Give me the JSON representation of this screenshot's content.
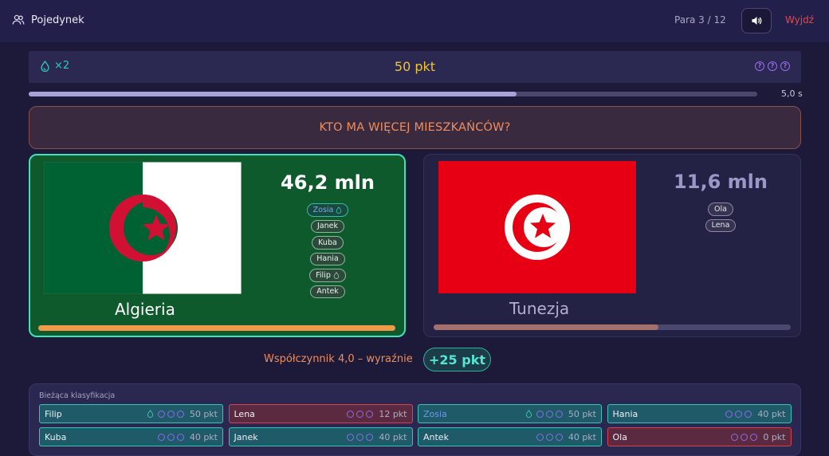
{
  "header": {
    "mode_label": "Pojedynek",
    "pair_counter": "Para 3 / 12",
    "exit_label": "Wyjdź",
    "icons": [
      "users-icon",
      "speaker-icon"
    ]
  },
  "status": {
    "streak": "×2",
    "points": "50 pkt",
    "hints_available": 3
  },
  "timer": {
    "label": "5,0 s",
    "progress": 0.67
  },
  "question": "KTO MA WIĘCEJ MIESZKAŃCÓW?",
  "left_card": {
    "country": "Algieria",
    "population": "46,2 mln",
    "vote_share": 1.0,
    "votes": [
      {
        "name": "Zosia",
        "special": true,
        "drop": true
      },
      {
        "name": "Janek",
        "special": false,
        "drop": false
      },
      {
        "name": "Kuba",
        "special": false,
        "drop": false
      },
      {
        "name": "Hania",
        "special": false,
        "drop": false
      },
      {
        "name": "Filip",
        "special": false,
        "drop": true
      },
      {
        "name": "Antek",
        "special": false,
        "drop": false
      }
    ]
  },
  "right_card": {
    "country": "Tunezja",
    "population": "11,6 mln",
    "vote_share": 0.63,
    "votes": [
      {
        "name": "Ola"
      },
      {
        "name": "Lena"
      }
    ]
  },
  "result": {
    "coefficient_text": "Współczynnik 4,0 – wyraźnie",
    "gain": "+25 pkt"
  },
  "colors": {
    "accent_teal": "#39c4b3",
    "accent_red": "#d9424f",
    "gold": "#f0c43a",
    "orange": "#ef8d5c"
  },
  "leaderboard": {
    "title": "Bieżąca klasyfikacja",
    "players": [
      {
        "name": "Filip",
        "points": "50 pkt",
        "status": "good",
        "drop": true,
        "special": false
      },
      {
        "name": "Lena",
        "points": "12 pkt",
        "status": "bad",
        "drop": false,
        "special": false
      },
      {
        "name": "Zosia",
        "points": "50 pkt",
        "status": "good",
        "drop": true,
        "special": true
      },
      {
        "name": "Hania",
        "points": "40 pkt",
        "status": "good",
        "drop": false,
        "special": false
      },
      {
        "name": "Kuba",
        "points": "40 pkt",
        "status": "good",
        "drop": false,
        "special": false
      },
      {
        "name": "Janek",
        "points": "40 pkt",
        "status": "good",
        "drop": false,
        "special": false
      },
      {
        "name": "Antek",
        "points": "40 pkt",
        "status": "good",
        "drop": false,
        "special": false
      },
      {
        "name": "Ola",
        "points": "0 pkt",
        "status": "bad",
        "drop": false,
        "special": false
      }
    ]
  }
}
